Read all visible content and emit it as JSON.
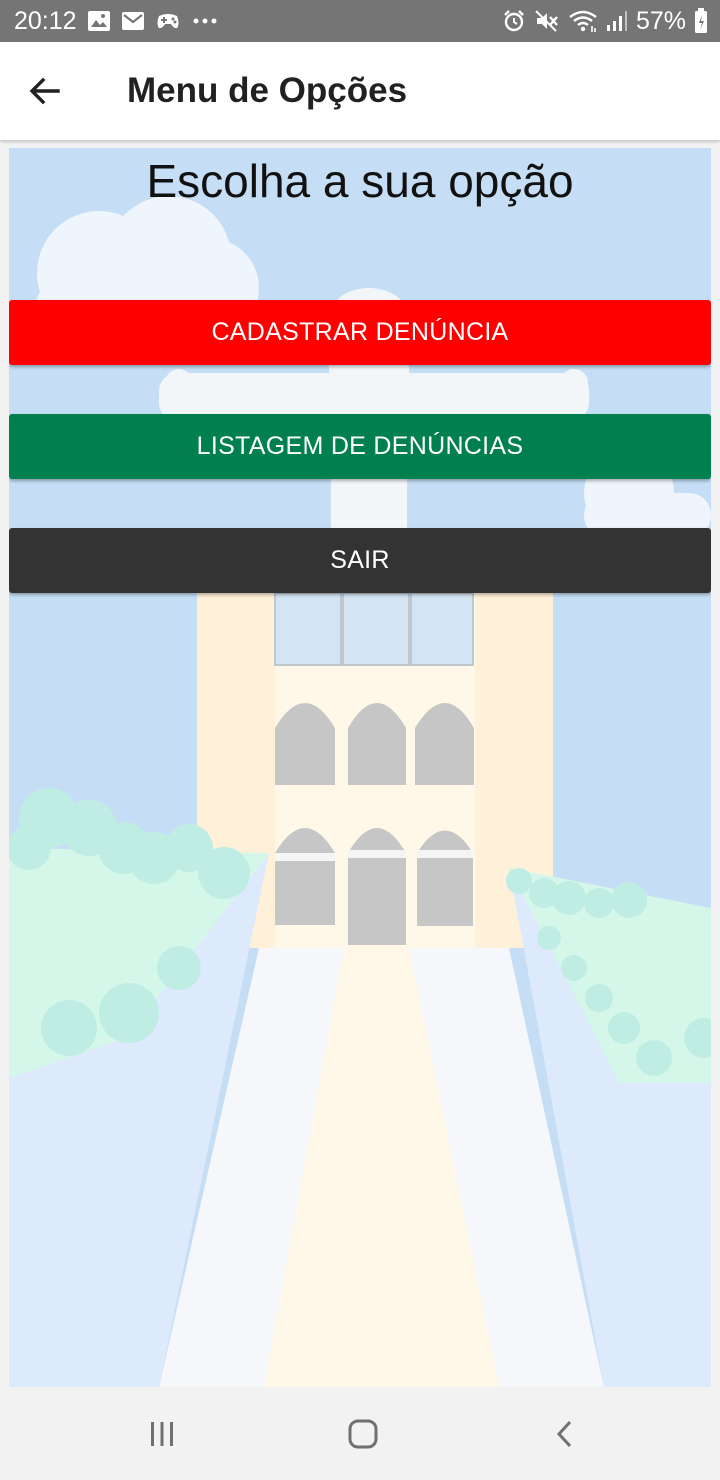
{
  "status_bar": {
    "time": "20:12",
    "battery_percent": "57%",
    "left_icons": [
      "image-icon",
      "mail-icon",
      "game-controller-icon",
      "more-dots-icon"
    ],
    "right_icons": [
      "alarm-icon",
      "mute-icon",
      "wifi-icon",
      "signal-icon",
      "battery-icon"
    ]
  },
  "app_bar": {
    "title": "Menu de Opções",
    "back_icon": "arrow-left-icon"
  },
  "content": {
    "heading": "Escolha a sua opção",
    "buttons": [
      {
        "label": "CADASTRAR DENÚNCIA",
        "color": "#ff0000"
      },
      {
        "label": "LISTAGEM DE DENÚNCIAS",
        "color": "#00804f"
      },
      {
        "label": "SAIR",
        "color": "#333333"
      }
    ]
  },
  "nav_bar": {
    "recent_icon": "recent-apps-icon",
    "home_icon": "home-icon",
    "back_icon": "chevron-left-icon"
  }
}
